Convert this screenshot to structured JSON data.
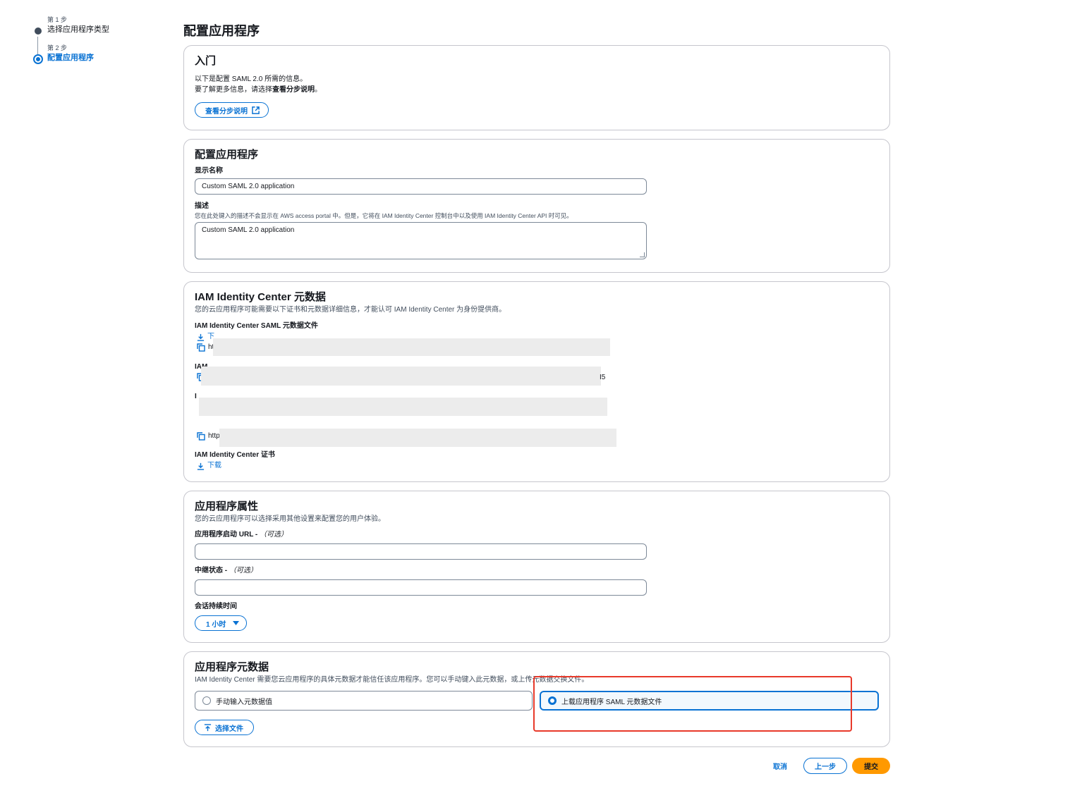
{
  "stepper": {
    "steps": [
      {
        "num": "第 1 步",
        "title": "选择应用程序类型"
      },
      {
        "num": "第 2 步",
        "title": "配置应用程序"
      }
    ]
  },
  "page_title": "配置应用程序",
  "getting_started": {
    "title": "入门",
    "line1": "以下是配置 SAML 2.0 所需的信息。",
    "line2_prefix": "要了解更多信息，请选择",
    "line2_bold": "查看分步说明",
    "line2_suffix": "。",
    "button": "查看分步说明"
  },
  "configure_app": {
    "title": "配置应用程序",
    "display_name_label": "显示名称",
    "display_name_value": "Custom SAML 2.0 application",
    "description_label": "描述",
    "description_hint": "您在此处键入的描述不会显示在 AWS access portal 中。但是，它将在 IAM Identity Center 控制台中以及使用 IAM Identity Center API 时可见。",
    "description_value": "Custom SAML 2.0 application"
  },
  "iam_metadata": {
    "title": "IAM Identity Center 元数据",
    "desc": "您的云应用程序可能需要以下证书和元数据详细信息，才能认可 IAM Identity Center 为身份提供商。",
    "saml_file_label": "IAM Identity Center SAML 元数据文件",
    "download_partial": "下",
    "url_partial_1": "ht",
    "label_partial_2": "IAM",
    "url_tail_2": "I5",
    "label_partial_3": "I",
    "url_partial_4": "http",
    "cert_label": "IAM Identity Center 证书",
    "cert_download": "下载"
  },
  "app_properties": {
    "title": "应用程序属性",
    "desc": "您的云应用程序可以选择采用其他设置来配置您的用户体验。",
    "start_url_label": "应用程序启动 URL - ",
    "start_url_optional": "（可选）",
    "relay_label": "中继状态 - ",
    "relay_optional": "（可选）",
    "session_label": "会话持续时间",
    "session_value": "1 小时"
  },
  "app_metadata": {
    "title": "应用程序元数据",
    "desc": "IAM Identity Center 需要您云应用程序的具体元数据才能信任该应用程序。您可以手动键入此元数据，或上传元数据交换文件。",
    "option_manual": "手动输入元数据值",
    "option_upload": "上载应用程序 SAML 元数据文件",
    "choose_file": "选择文件"
  },
  "footer": {
    "cancel": "取消",
    "previous": "上一步",
    "submit": "提交"
  },
  "colors": {
    "accent": "#0972d3",
    "submit": "#ff9900",
    "highlight": "#e8392a"
  }
}
